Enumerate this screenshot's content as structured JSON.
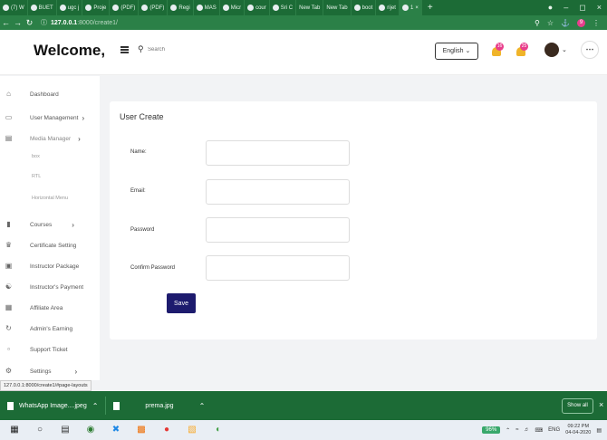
{
  "browser": {
    "tabs": [
      {
        "label": "(7) W"
      },
      {
        "label": "BUET"
      },
      {
        "label": "ugc j"
      },
      {
        "label": "Proje"
      },
      {
        "label": "(PDF)"
      },
      {
        "label": "(PDF)"
      },
      {
        "label": "Regi"
      },
      {
        "label": "MAS"
      },
      {
        "label": "Micr"
      },
      {
        "label": "cour"
      },
      {
        "label": "Sri C"
      },
      {
        "label": "New Tab"
      },
      {
        "label": "New Tab"
      },
      {
        "label": "boot"
      },
      {
        "label": "rijet"
      },
      {
        "label": "1"
      }
    ],
    "url_host": "127.0.0.1",
    "url_path": ":8000/create1/",
    "profile_badge": "9"
  },
  "header": {
    "welcome": "Welcome,",
    "search_placeholder": "Search",
    "language": "English",
    "bell1_badge": "16",
    "bell2_badge": "25"
  },
  "sidebar": {
    "items": [
      {
        "label": "Dashboard",
        "icon": "home-icon"
      },
      {
        "label": "User Management",
        "icon": "monitor-icon"
      },
      {
        "label": "Media Manager",
        "icon": "image-icon"
      },
      {
        "label": "box"
      },
      {
        "label": "RTL"
      },
      {
        "label": "Horizontal Menu"
      },
      {
        "label": "Courses",
        "icon": "book-icon"
      },
      {
        "label": "Certificate Setting",
        "icon": "certificate-icon"
      },
      {
        "label": "Instructor Package",
        "icon": "package-icon"
      },
      {
        "label": "Instructor's Payment",
        "icon": "payment-icon"
      },
      {
        "label": "Affiliate Area",
        "icon": "affiliate-icon"
      },
      {
        "label": "Admin's Earning",
        "icon": "earning-icon"
      },
      {
        "label": "Support Ticket",
        "icon": "ticket-icon"
      },
      {
        "label": "Settings",
        "icon": "gear-icon"
      }
    ]
  },
  "form": {
    "title": "User Create",
    "name_label": "Name:",
    "email_label": "Email:",
    "password_label": "Password",
    "confirm_label": "Confirm Password",
    "save_label": "Save"
  },
  "status_url": "127.0.0.1:8000/create1/#page-layouts",
  "downloads": [
    {
      "name": "WhatsApp Image....jpeg"
    },
    {
      "name": "prema.jpg"
    }
  ],
  "shelf": {
    "show_all": "Show all"
  },
  "taskbar": {
    "battery": "96%",
    "lang": "ENG",
    "time": "09:22 PM",
    "date": "04-04-2020"
  },
  "colors": {
    "browser_green": "#1c6b36",
    "save_button": "#1d1b6e",
    "badge_pink": "#e83e8c",
    "bell_yellow": "#f0b429"
  }
}
